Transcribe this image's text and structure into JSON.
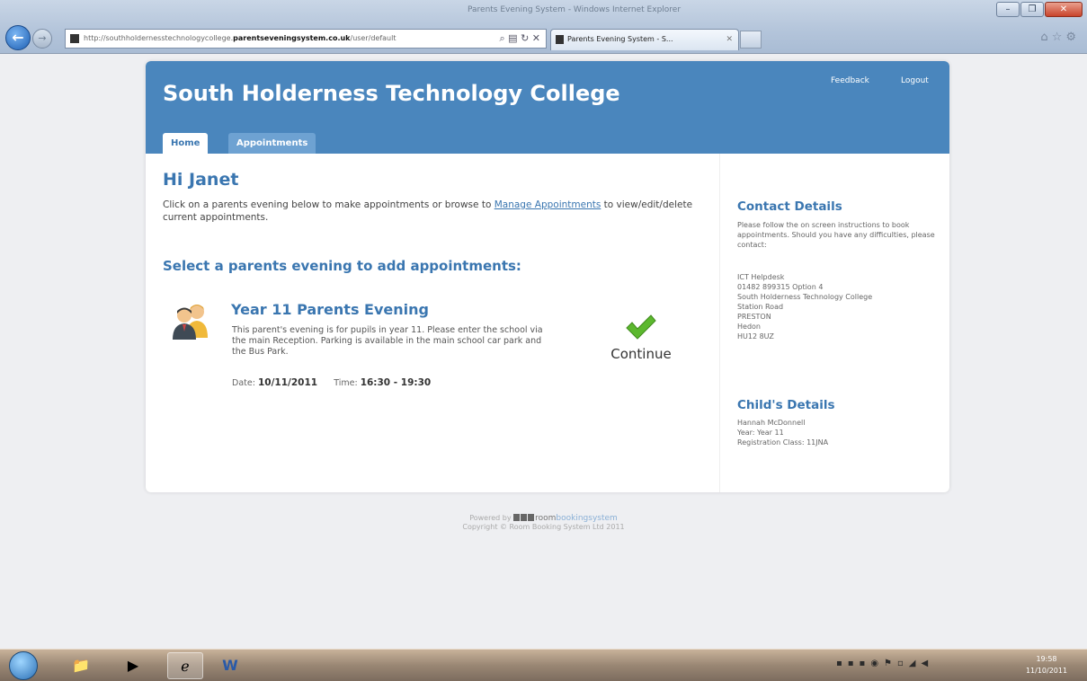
{
  "browser": {
    "window_title": "Parents Evening System - Windows Internet Explorer",
    "url_prefix": "http://southholdernesstechnologycollege.",
    "url_domain": "parentseveningsystem.co.uk",
    "url_suffix": "/user/default",
    "tab_title": "Parents Evening System - S...",
    "window_controls": [
      "–",
      "❐",
      "✕"
    ]
  },
  "header": {
    "site_title": "South Holderness Technology College",
    "links": [
      "Feedback",
      "Logout"
    ],
    "tabs": [
      "Home",
      "Appointments"
    ]
  },
  "main": {
    "greeting": "Hi Janet",
    "intro_before": "Click on a parents evening below to make appointments or browse to ",
    "intro_link": "Manage Appointments",
    "intro_after": " to view/edit/delete current appointments.",
    "select_heading": "Select a parents evening to add appointments:",
    "event": {
      "title": "Year 11 Parents Evening",
      "description": "This parent's evening is for pupils in year 11. Please enter the school via the main Reception. Parking is available in the main school car park and the Bus Park.",
      "date_label": "Date:",
      "date_value": "10/11/2011",
      "time_label": "Time:",
      "time_value": "16:30 - 19:30",
      "continue_label": "Continue"
    }
  },
  "sidebar": {
    "contact_heading": "Contact Details",
    "contact_intro": "Please follow the on screen instructions to book appointments. Should you have any difficulties, please contact:",
    "contact_lines": [
      "ICT Helpdesk",
      "01482 899315 Option 4",
      "South Holderness Technology College",
      "Station Road",
      "PRESTON",
      "Hedon",
      "HU12 8UZ"
    ],
    "child_heading": "Child's Details",
    "child_lines": [
      "Hannah McDonnell",
      "Year: Year 11",
      "Registration Class: 11JNA"
    ]
  },
  "footer": {
    "powered_by": "Powered by",
    "logo_text_a": "room",
    "logo_text_b": "bookingsystem",
    "copyright": "Copyright © Room Booking System Ltd 2011"
  },
  "taskbar": {
    "time": "19:58",
    "date": "11/10/2011"
  }
}
